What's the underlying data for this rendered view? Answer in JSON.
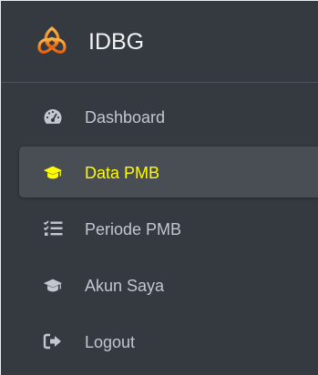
{
  "brand": {
    "name": "IDBG",
    "logo_icon": "triquetra-logo-icon"
  },
  "colors": {
    "sidebar_bg": "#343a40",
    "active_bg": "#494e54",
    "active_text": "#fffc00",
    "text": "#c2c7d0",
    "logo_orange": "#f2880f"
  },
  "nav": {
    "items": [
      {
        "label": "Dashboard",
        "icon": "tachometer-icon",
        "active": false
      },
      {
        "label": "Data PMB",
        "icon": "graduation-cap-icon",
        "active": true
      },
      {
        "label": "Periode PMB",
        "icon": "tasks-list-icon",
        "active": false
      },
      {
        "label": "Akun Saya",
        "icon": "graduation-cap-icon",
        "active": false
      },
      {
        "label": "Logout",
        "icon": "sign-out-icon",
        "active": false
      }
    ]
  }
}
